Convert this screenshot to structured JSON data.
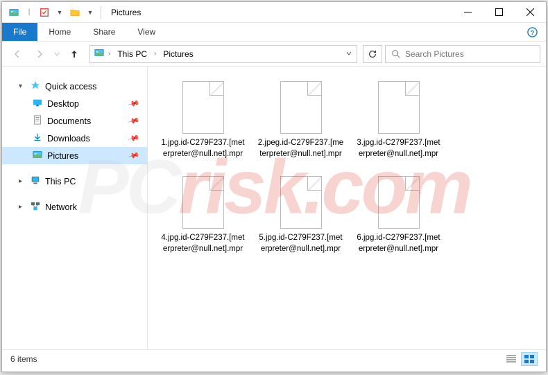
{
  "window": {
    "title": "Pictures"
  },
  "ribbon": {
    "file": "File",
    "tabs": [
      "Home",
      "Share",
      "View"
    ]
  },
  "breadcrumbs": {
    "items": [
      "This PC",
      "Pictures"
    ]
  },
  "search": {
    "placeholder": "Search Pictures"
  },
  "sidebar": {
    "quick_access": "Quick access",
    "quick_items": [
      {
        "label": "Desktop",
        "pinned": true
      },
      {
        "label": "Documents",
        "pinned": true
      },
      {
        "label": "Downloads",
        "pinned": true
      },
      {
        "label": "Pictures",
        "pinned": true,
        "selected": true
      }
    ],
    "this_pc": "This PC",
    "network": "Network"
  },
  "files": [
    {
      "name": "1.jpg.id-C279F237.[meterpreter@null.net].mpr"
    },
    {
      "name": "2.jpeg.id-C279F237.[meterpreter@null.net].mpr"
    },
    {
      "name": "3.jpg.id-C279F237.[meterpreter@null.net].mpr"
    },
    {
      "name": "4.jpg.id-C279F237.[meterpreter@null.net].mpr"
    },
    {
      "name": "5.jpg.id-C279F237.[meterpreter@null.net].mpr"
    },
    {
      "name": "6.jpg.id-C279F237.[meterpreter@null.net].mpr"
    }
  ],
  "statusbar": {
    "count": "6 items"
  },
  "watermark": {
    "part1": "PC",
    "part2": "risk.com"
  }
}
